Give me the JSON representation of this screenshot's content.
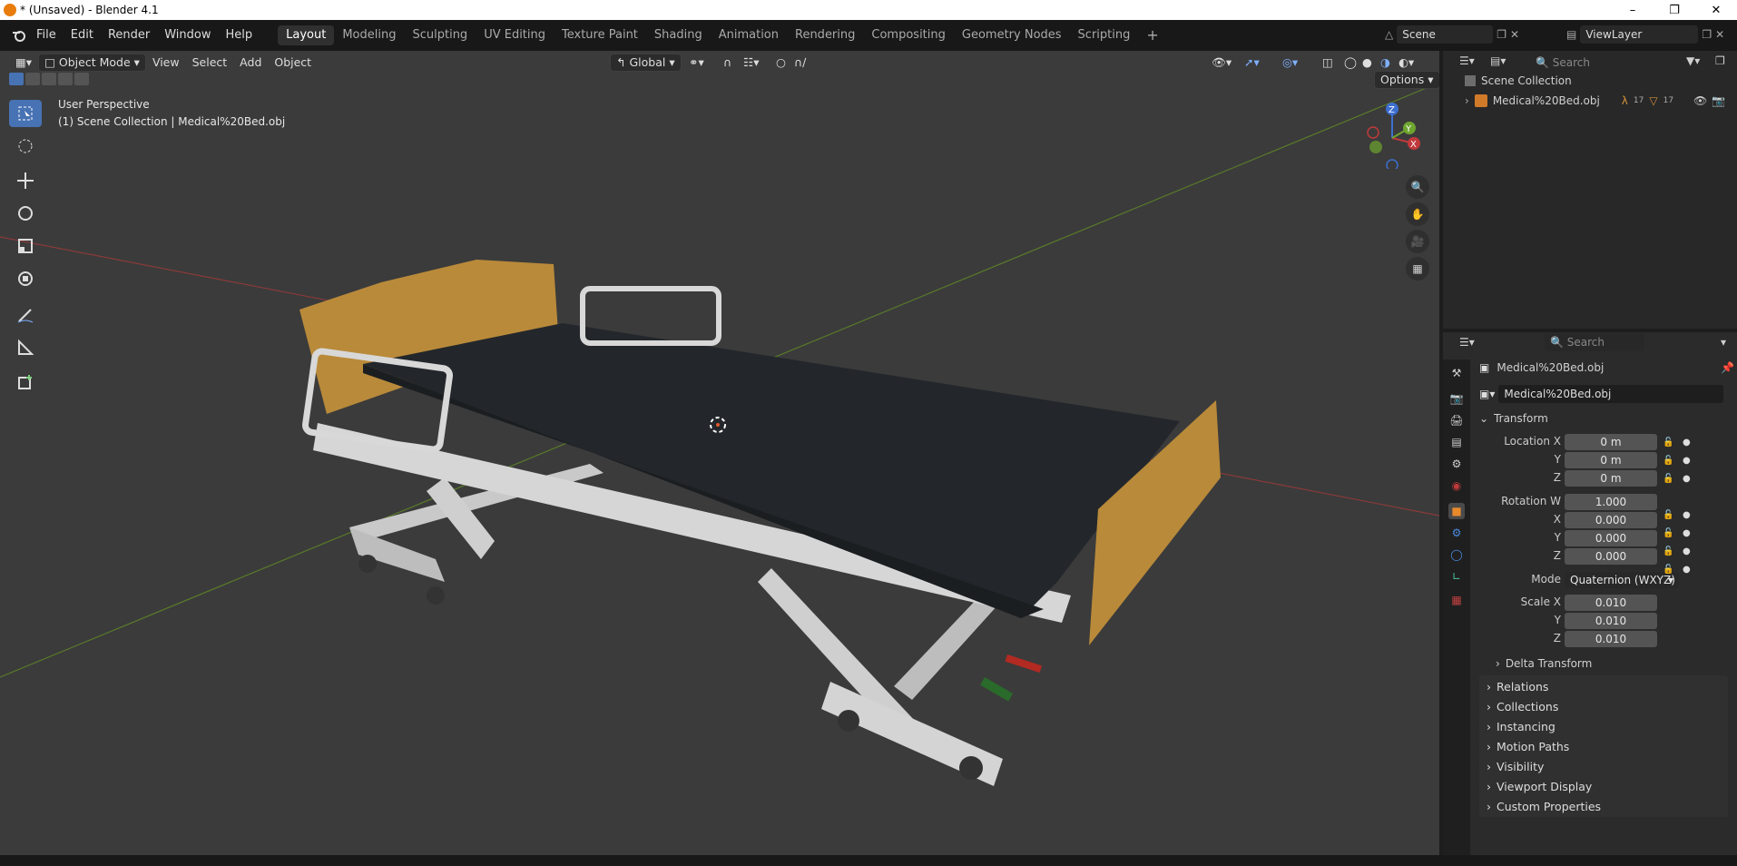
{
  "window": {
    "title": "* (Unsaved) - Blender 4.1"
  },
  "menus": [
    "File",
    "Edit",
    "Render",
    "Window",
    "Help"
  ],
  "workspaces": [
    "Layout",
    "Modeling",
    "Sculpting",
    "UV Editing",
    "Texture Paint",
    "Shading",
    "Animation",
    "Rendering",
    "Compositing",
    "Geometry Nodes",
    "Scripting"
  ],
  "active_workspace": "Layout",
  "scene": {
    "name": "Scene",
    "view_layer": "ViewLayer"
  },
  "viewport": {
    "mode": "Object Mode",
    "menus": [
      "View",
      "Select",
      "Add",
      "Object"
    ],
    "orientation": "Global",
    "options_label": "Options",
    "overlay_line1": "User Perspective",
    "overlay_line2": "(1) Scene Collection | Medical%20Bed.obj",
    "gizmo": {
      "x": "X",
      "y": "Y",
      "z": "Z"
    }
  },
  "outliner": {
    "search_placeholder": "Search",
    "root": "Scene Collection",
    "items": [
      {
        "name": "Medical%20Bed.obj",
        "count_a": "17",
        "count_b": "17"
      }
    ]
  },
  "properties": {
    "search_placeholder": "Search",
    "object_name": "Medical%20Bed.obj",
    "data_name": "Medical%20Bed.obj",
    "transform": {
      "header": "Transform",
      "location_label": "Location X",
      "location": [
        "0 m",
        "0 m",
        "0 m"
      ],
      "rotation_label": "Rotation W",
      "rotation": [
        "1.000",
        "0.000",
        "0.000",
        "0.000"
      ],
      "mode_label": "Mode",
      "mode": "Quaternion (WXYZ)",
      "scale_label": "Scale X",
      "scale": [
        "0.010",
        "0.010",
        "0.010"
      ],
      "axis_y": "Y",
      "axis_z": "Z",
      "axis_x": "X",
      "delta": "Delta Transform"
    },
    "panels": [
      "Relations",
      "Collections",
      "Instancing",
      "Motion Paths",
      "Visibility",
      "Viewport Display",
      "Custom Properties"
    ]
  }
}
